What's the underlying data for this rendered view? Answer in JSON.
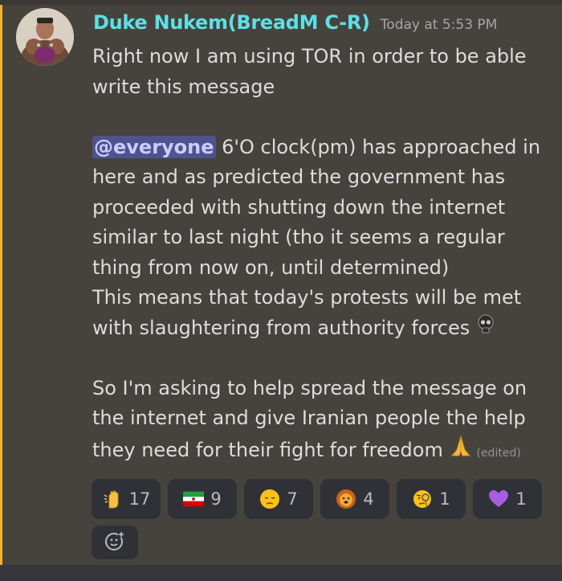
{
  "message": {
    "author": "Duke Nukem(BreadM C-R)",
    "timestamp": "Today at 5:53 PM",
    "line1": "Right now I am using TOR in order to be able write this message",
    "mention": "@everyone",
    "para2": " 6'O clock(pm) has approached in here and as predicted the government has proceeded with shutting down the internet similar to last night (tho it seems a regular thing from now on, until determined)",
    "para3": "This means that today's protests will be met with slaughtering from authority forces ",
    "para4": "So I'm asking to help spread the message on the internet and give Iranian people the help they need for their fight for freedom ",
    "edited": "(edited)"
  },
  "reactions": [
    {
      "icon": "raised-hand-emoji",
      "count": "17"
    },
    {
      "icon": "iran-flag-emoji",
      "count": "9"
    },
    {
      "icon": "pensive-face-emoji",
      "count": "7"
    },
    {
      "icon": "lion-face-emoji",
      "count": "4"
    },
    {
      "icon": "monocle-face-emoji",
      "count": "1"
    },
    {
      "icon": "purple-heart-emoji",
      "count": "1"
    }
  ],
  "colors": {
    "background": "#46433d",
    "mention_bar": "#f0b232",
    "username": "#5de0e6",
    "reaction_bg": "#2f3136"
  }
}
